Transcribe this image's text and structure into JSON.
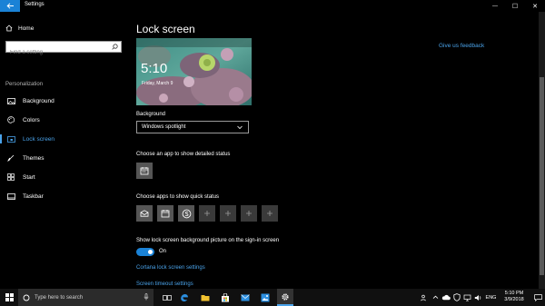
{
  "window": {
    "title": "Settings",
    "controls": {
      "minimize": "—",
      "maximize": "☐",
      "close": "✕"
    }
  },
  "sidebar": {
    "home_label": "Home",
    "search_placeholder": "Find a setting",
    "section_label": "Personalization",
    "items": [
      {
        "label": "Background",
        "icon": "picture-icon",
        "active": false
      },
      {
        "label": "Colors",
        "icon": "palette-icon",
        "active": false
      },
      {
        "label": "Lock screen",
        "icon": "lock-screen-icon",
        "active": true
      },
      {
        "label": "Themes",
        "icon": "brush-icon",
        "active": false
      },
      {
        "label": "Start",
        "icon": "start-icon",
        "active": false
      },
      {
        "label": "Taskbar",
        "icon": "taskbar-icon",
        "active": false
      }
    ]
  },
  "main": {
    "page_title": "Lock screen",
    "preview": {
      "time": "5:10",
      "date": "Friday, March 9"
    },
    "feedback_link": "Give us feedback",
    "background_label": "Background",
    "background_value": "Windows spotlight",
    "detailed_status_label": "Choose an app to show detailed status",
    "quick_status_label": "Choose apps to show quick status",
    "signin_label": "Show lock screen background picture on the sign-in screen",
    "signin_toggle_state": "On",
    "cortana_link": "Cortana lock screen settings",
    "timeout_link": "Screen timeout settings"
  },
  "taskbar": {
    "search_placeholder": "Type here to search",
    "language": "ENG",
    "time": "5:10 PM",
    "date": "3/9/2018"
  },
  "colors": {
    "accent": "#1a82d6",
    "link": "#4aa3ea"
  }
}
